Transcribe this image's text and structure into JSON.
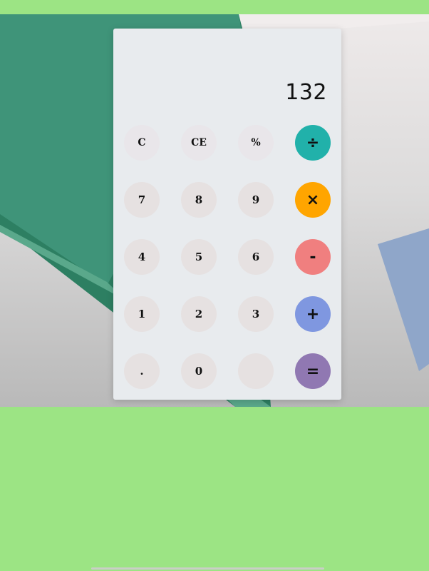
{
  "display": {
    "value": "132"
  },
  "keys": {
    "clear": "C",
    "clear_entry": "CE",
    "percent": "%",
    "divide": "÷",
    "seven": "7",
    "eight": "8",
    "nine": "9",
    "multiply": "×",
    "four": "4",
    "five": "5",
    "six": "6",
    "subtract": "-",
    "one": "1",
    "two": "2",
    "three": "3",
    "add": "+",
    "decimal": ".",
    "zero": "0",
    "blank": "",
    "equals": "="
  },
  "colors": {
    "background_green": "#9ce484",
    "panel": "#e8ebee",
    "number_key": "#e6e1e1",
    "divide_key": "#21b1aa",
    "multiply_key": "#ffa500",
    "subtract_key": "#f07f7f",
    "add_key": "#7f97e0",
    "equals_key": "#9078b2"
  }
}
